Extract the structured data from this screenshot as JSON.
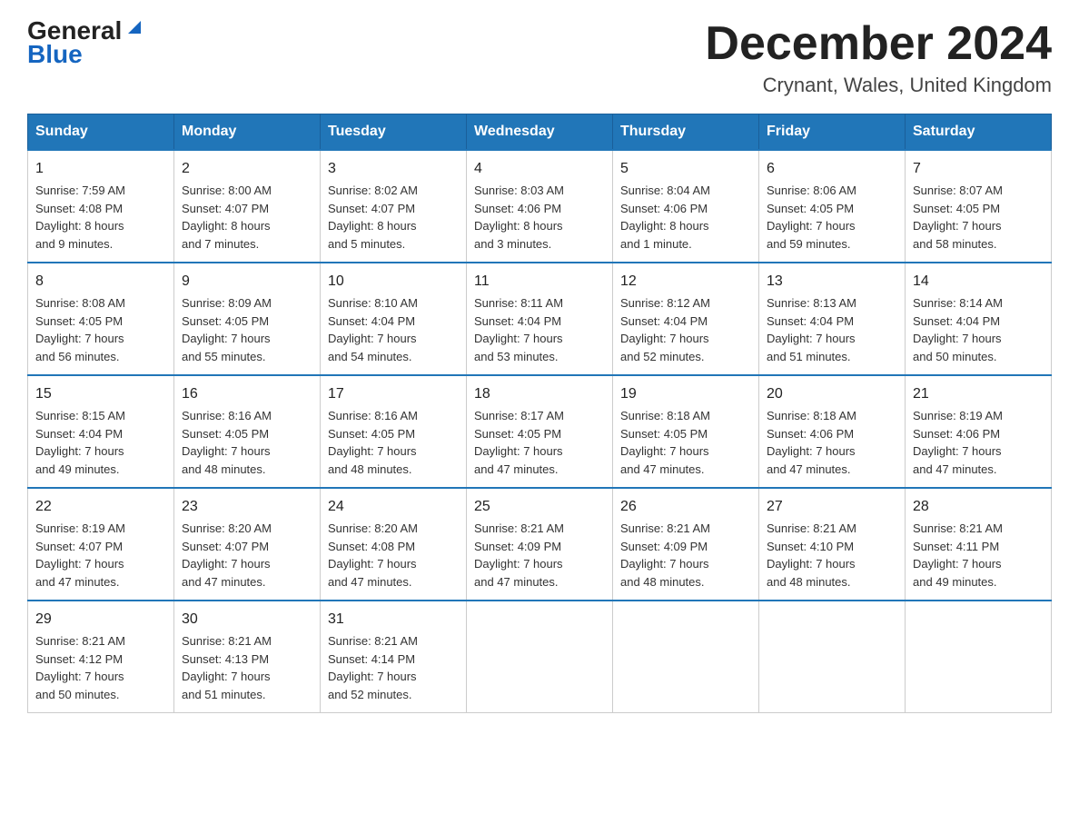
{
  "header": {
    "logo_general": "General",
    "logo_blue": "Blue",
    "month_title": "December 2024",
    "location": "Crynant, Wales, United Kingdom"
  },
  "weekdays": [
    "Sunday",
    "Monday",
    "Tuesday",
    "Wednesday",
    "Thursday",
    "Friday",
    "Saturday"
  ],
  "weeks": [
    [
      {
        "day": "1",
        "info": "Sunrise: 7:59 AM\nSunset: 4:08 PM\nDaylight: 8 hours\nand 9 minutes."
      },
      {
        "day": "2",
        "info": "Sunrise: 8:00 AM\nSunset: 4:07 PM\nDaylight: 8 hours\nand 7 minutes."
      },
      {
        "day": "3",
        "info": "Sunrise: 8:02 AM\nSunset: 4:07 PM\nDaylight: 8 hours\nand 5 minutes."
      },
      {
        "day": "4",
        "info": "Sunrise: 8:03 AM\nSunset: 4:06 PM\nDaylight: 8 hours\nand 3 minutes."
      },
      {
        "day": "5",
        "info": "Sunrise: 8:04 AM\nSunset: 4:06 PM\nDaylight: 8 hours\nand 1 minute."
      },
      {
        "day": "6",
        "info": "Sunrise: 8:06 AM\nSunset: 4:05 PM\nDaylight: 7 hours\nand 59 minutes."
      },
      {
        "day": "7",
        "info": "Sunrise: 8:07 AM\nSunset: 4:05 PM\nDaylight: 7 hours\nand 58 minutes."
      }
    ],
    [
      {
        "day": "8",
        "info": "Sunrise: 8:08 AM\nSunset: 4:05 PM\nDaylight: 7 hours\nand 56 minutes."
      },
      {
        "day": "9",
        "info": "Sunrise: 8:09 AM\nSunset: 4:05 PM\nDaylight: 7 hours\nand 55 minutes."
      },
      {
        "day": "10",
        "info": "Sunrise: 8:10 AM\nSunset: 4:04 PM\nDaylight: 7 hours\nand 54 minutes."
      },
      {
        "day": "11",
        "info": "Sunrise: 8:11 AM\nSunset: 4:04 PM\nDaylight: 7 hours\nand 53 minutes."
      },
      {
        "day": "12",
        "info": "Sunrise: 8:12 AM\nSunset: 4:04 PM\nDaylight: 7 hours\nand 52 minutes."
      },
      {
        "day": "13",
        "info": "Sunrise: 8:13 AM\nSunset: 4:04 PM\nDaylight: 7 hours\nand 51 minutes."
      },
      {
        "day": "14",
        "info": "Sunrise: 8:14 AM\nSunset: 4:04 PM\nDaylight: 7 hours\nand 50 minutes."
      }
    ],
    [
      {
        "day": "15",
        "info": "Sunrise: 8:15 AM\nSunset: 4:04 PM\nDaylight: 7 hours\nand 49 minutes."
      },
      {
        "day": "16",
        "info": "Sunrise: 8:16 AM\nSunset: 4:05 PM\nDaylight: 7 hours\nand 48 minutes."
      },
      {
        "day": "17",
        "info": "Sunrise: 8:16 AM\nSunset: 4:05 PM\nDaylight: 7 hours\nand 48 minutes."
      },
      {
        "day": "18",
        "info": "Sunrise: 8:17 AM\nSunset: 4:05 PM\nDaylight: 7 hours\nand 47 minutes."
      },
      {
        "day": "19",
        "info": "Sunrise: 8:18 AM\nSunset: 4:05 PM\nDaylight: 7 hours\nand 47 minutes."
      },
      {
        "day": "20",
        "info": "Sunrise: 8:18 AM\nSunset: 4:06 PM\nDaylight: 7 hours\nand 47 minutes."
      },
      {
        "day": "21",
        "info": "Sunrise: 8:19 AM\nSunset: 4:06 PM\nDaylight: 7 hours\nand 47 minutes."
      }
    ],
    [
      {
        "day": "22",
        "info": "Sunrise: 8:19 AM\nSunset: 4:07 PM\nDaylight: 7 hours\nand 47 minutes."
      },
      {
        "day": "23",
        "info": "Sunrise: 8:20 AM\nSunset: 4:07 PM\nDaylight: 7 hours\nand 47 minutes."
      },
      {
        "day": "24",
        "info": "Sunrise: 8:20 AM\nSunset: 4:08 PM\nDaylight: 7 hours\nand 47 minutes."
      },
      {
        "day": "25",
        "info": "Sunrise: 8:21 AM\nSunset: 4:09 PM\nDaylight: 7 hours\nand 47 minutes."
      },
      {
        "day": "26",
        "info": "Sunrise: 8:21 AM\nSunset: 4:09 PM\nDaylight: 7 hours\nand 48 minutes."
      },
      {
        "day": "27",
        "info": "Sunrise: 8:21 AM\nSunset: 4:10 PM\nDaylight: 7 hours\nand 48 minutes."
      },
      {
        "day": "28",
        "info": "Sunrise: 8:21 AM\nSunset: 4:11 PM\nDaylight: 7 hours\nand 49 minutes."
      }
    ],
    [
      {
        "day": "29",
        "info": "Sunrise: 8:21 AM\nSunset: 4:12 PM\nDaylight: 7 hours\nand 50 minutes."
      },
      {
        "day": "30",
        "info": "Sunrise: 8:21 AM\nSunset: 4:13 PM\nDaylight: 7 hours\nand 51 minutes."
      },
      {
        "day": "31",
        "info": "Sunrise: 8:21 AM\nSunset: 4:14 PM\nDaylight: 7 hours\nand 52 minutes."
      },
      {
        "day": "",
        "info": ""
      },
      {
        "day": "",
        "info": ""
      },
      {
        "day": "",
        "info": ""
      },
      {
        "day": "",
        "info": ""
      }
    ]
  ]
}
